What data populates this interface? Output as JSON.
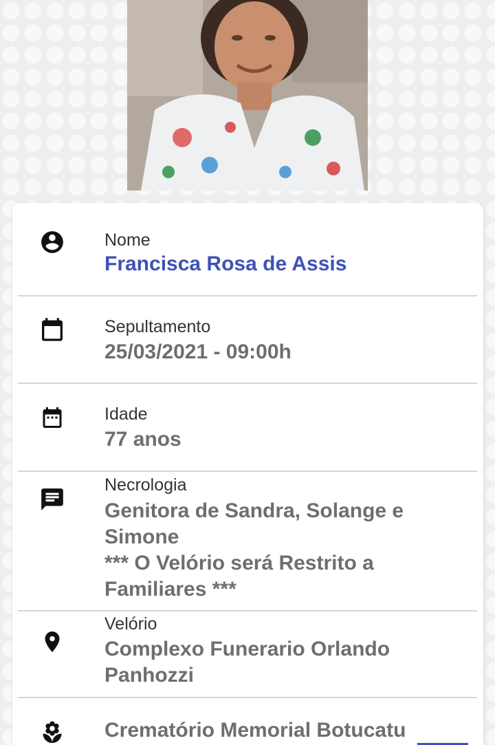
{
  "profile": {
    "photo_alt": "Francisca Rosa de Assis"
  },
  "fields": [
    {
      "label": "Nome",
      "value": "Francisca Rosa de Assis",
      "icon": "person-circle-icon"
    },
    {
      "label": "Sepultamento",
      "value": "25/03/2021 - 09:00h",
      "icon": "calendar-icon"
    },
    {
      "label": "Idade",
      "value": "77 anos",
      "icon": "calendar-dots-icon"
    },
    {
      "label": "Necrologia",
      "value_lines": [
        "Genitora de Sandra, Solange e",
        "Simone",
        "*** O Velório será Restrito a",
        "Familiares ***"
      ],
      "icon": "message-icon"
    },
    {
      "label": "Velório",
      "value_lines": [
        "Complexo Funerario Orlando",
        "Panhozzi"
      ],
      "icon": "location-pin-icon"
    },
    {
      "label": "",
      "value": "Crematório Memorial Botucatu",
      "icon": "flower-icon"
    }
  ],
  "colors": {
    "accent": "#3f51b5",
    "value_gray": "#6e6e6e",
    "label": "#333333",
    "divider": "#d6d6d6"
  }
}
